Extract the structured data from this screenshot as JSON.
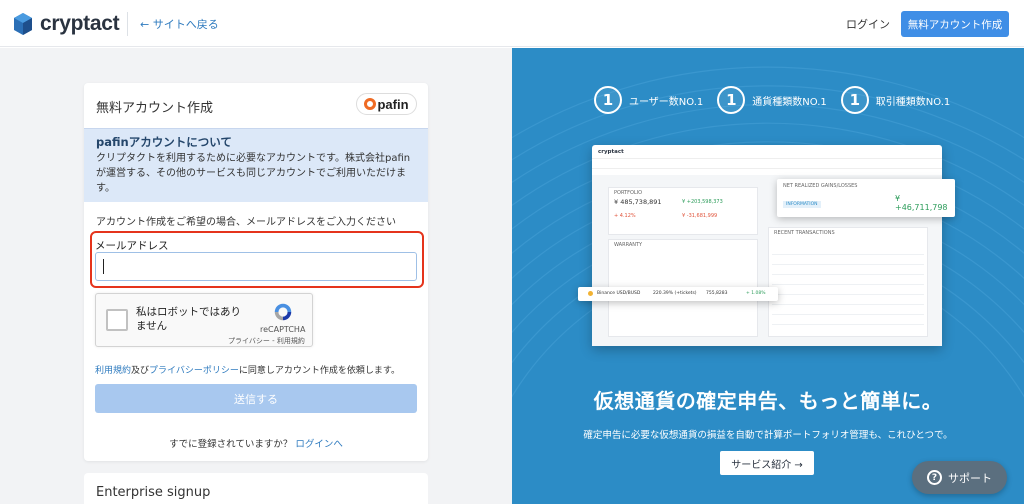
{
  "header": {
    "logo_text": "cryptact",
    "back_link": "← サイトへ戻る",
    "login": "ログイン",
    "signup": "無料アカウント作成"
  },
  "form_card": {
    "title": "無料アカウント作成",
    "partner_logo_text": "pafin",
    "info_title": "pafinアカウントについて",
    "info_body_line1": "クリプタクトを利用するために必要なアカウントです。株式会社pafin",
    "info_body_line2": "が運営する、その他のサービスも同じアカウントでご利用いただけま",
    "info_body_line3": "す。",
    "prompt": "アカウント作成をご希望の場合、メールアドレスをご入力ください",
    "email_label": "メールアドレス",
    "email_value": "",
    "recaptcha": {
      "label_line1": "私はロボットではあり",
      "label_line2": "ません",
      "brand": "reCAPTCHA",
      "links": "プライバシー - 利用規約"
    },
    "terms_link": "利用規約",
    "terms_and": "及び",
    "privacy_link": "プライバシーポリシー",
    "terms_suffix": "に同意しアカウント作成を依頼します。",
    "submit": "送信する",
    "already_text": "すでに登録されていますか？",
    "already_link": "ログインへ"
  },
  "enterprise_card": {
    "title": "Enterprise signup"
  },
  "promo": {
    "badges": [
      {
        "num": "1",
        "label": "ユーザー数NO.1"
      },
      {
        "num": "1",
        "label": "通貨種類数NO.1"
      },
      {
        "num": "1",
        "label": "取引種類数NO.1"
      }
    ],
    "headline": "仮想通貨の確定申告、もっと簡単に。",
    "subline": "確定申告に必要な仮想通貨の損益を自動で計算ポートフォリオ管理も、これひとつで。",
    "service_button": "サービス紹介 →",
    "mock": {
      "logo": "cryptact",
      "portfolio_label": "PORTFOLIO",
      "portfolio_value": "¥ 485,738,891",
      "portfolio_pct": "+ 4.12%",
      "portfolio_gain": "¥ +203,598,373",
      "portfolio_loss": "¥ -31,681,999",
      "net_label": "NET REALIZED GAINS/LOSSES",
      "net_value": "¥ +46,711,798",
      "information": "INFORMATION",
      "warranty": "WARRANTY",
      "recent": "RECENT TRANSACTIONS",
      "row_coin": "Binance USD/BUSD",
      "row_amount": "220.39% (+tickets)",
      "row_value": "755,8283",
      "row_pct": "+ 1.08%"
    }
  },
  "support": {
    "icon_text": "?",
    "label": "サポート"
  },
  "colors": {
    "accent": "#3f8ee6",
    "promo_bg": "#2c8cc6",
    "highlight": "#e5341c",
    "info_bg": "#dce8f8"
  }
}
